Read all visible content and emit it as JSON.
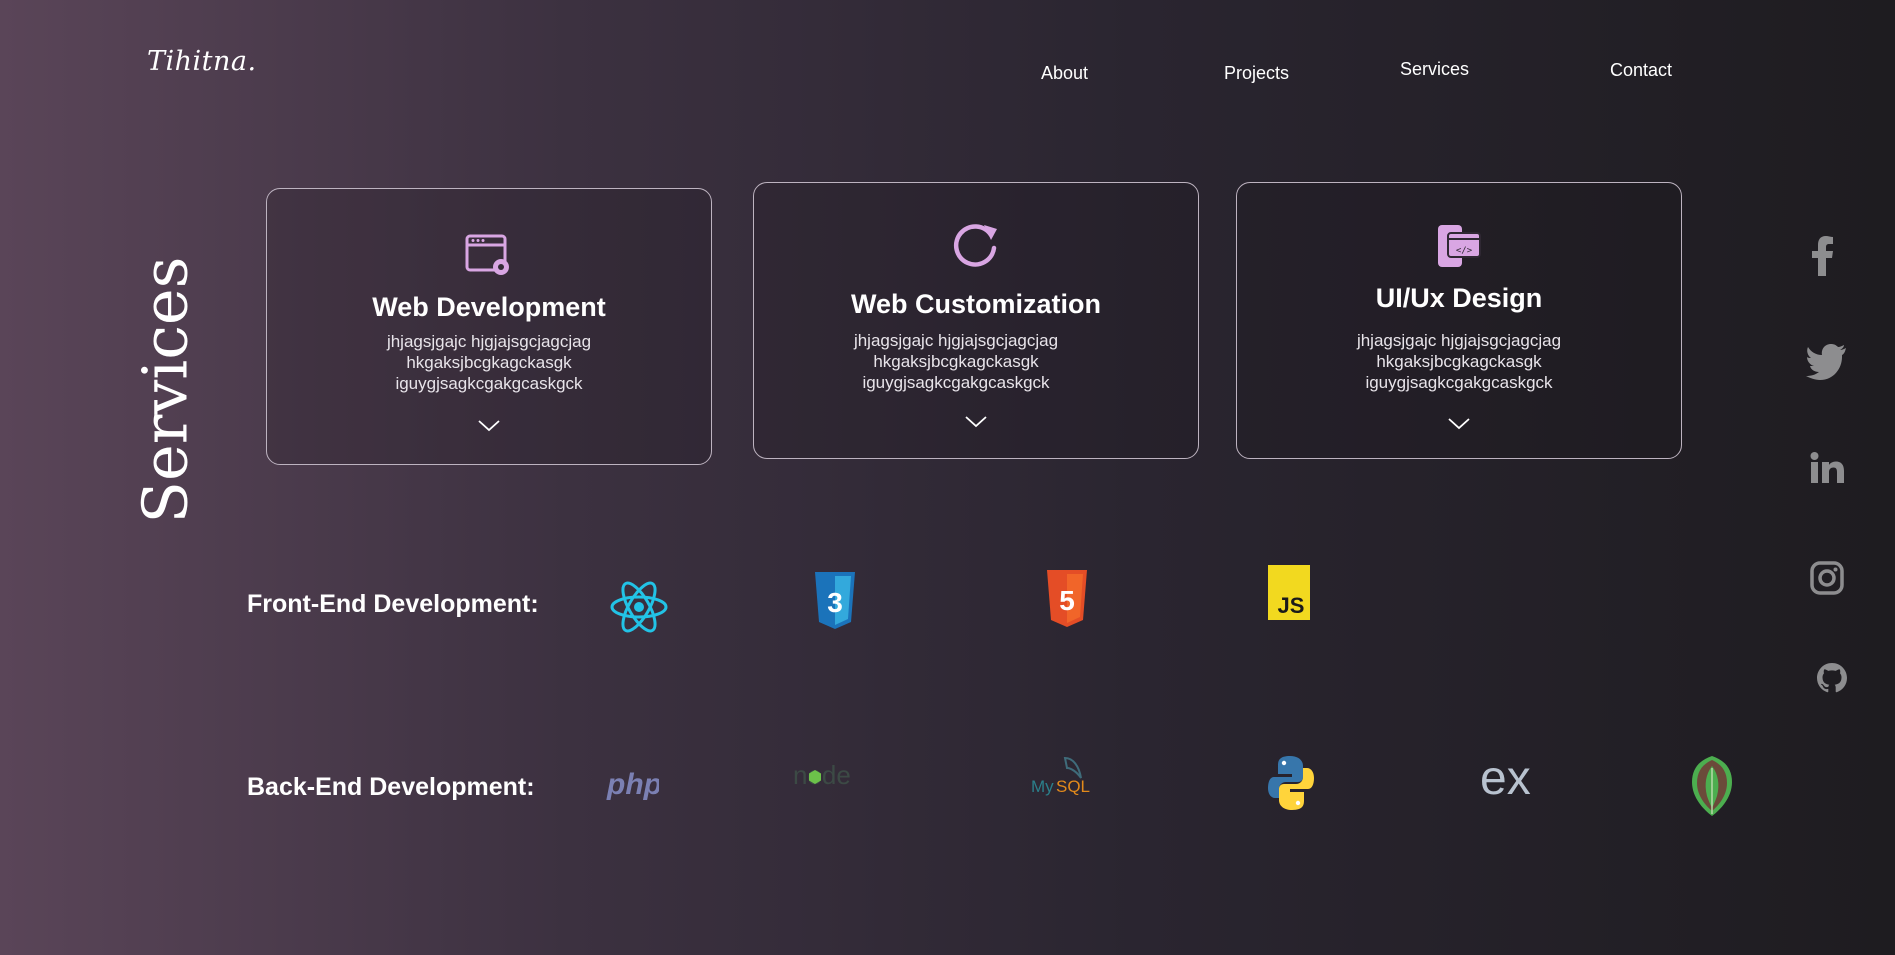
{
  "logo": "Tihitna.",
  "nav": {
    "about": "About",
    "projects": "Projects",
    "services": "Services",
    "contact": "Contact"
  },
  "section_title": "Services",
  "cards": [
    {
      "title": "Web Development",
      "line1": "jhjagsjgajc hjgjajsgcjagcjag",
      "line2": "hkgaksjbcgkagckasgk",
      "line3": "iguygjsagkcgakgcaskgck",
      "icon": "browser-settings-icon"
    },
    {
      "title": "Web Customization",
      "line1": "jhjagsjgajc hjgjajsgcjagcjag",
      "line2": "hkgaksjbcgkagckasgk",
      "line3": "iguygjsagkcgakgcaskgck",
      "icon": "refresh-icon"
    },
    {
      "title": "UI/Ux Design",
      "line1": "jhjagsjgajc hjgjajsgcjagcjag",
      "line2": "hkgaksjbcgkagckasgk",
      "line3": "iguygjsagkcgakgcaskgck",
      "icon": "mobile-code-icon"
    }
  ],
  "frontend": {
    "label": "Front-End Development:",
    "icons": [
      "react-icon",
      "css3-icon",
      "html5-icon",
      "javascript-icon"
    ],
    "js_text": "JS",
    "css_text": "3",
    "html_text": "5"
  },
  "backend": {
    "label": "Back-End Development:",
    "icons": [
      "php-icon",
      "nodejs-icon",
      "mysql-icon",
      "python-icon",
      "express-icon",
      "mongodb-icon"
    ],
    "php_text": "php",
    "node_text": "node",
    "mysql_my": "My",
    "mysql_sql": "SQL",
    "express_text": "ex"
  },
  "social": [
    "facebook-icon",
    "twitter-icon",
    "linkedin-icon",
    "instagram-icon",
    "github-icon"
  ],
  "colors": {
    "accent": "#d9a6e3",
    "react": "#22c3e6",
    "css": "#1b73ba",
    "html": "#e44d26",
    "js": "#f2d91f"
  }
}
